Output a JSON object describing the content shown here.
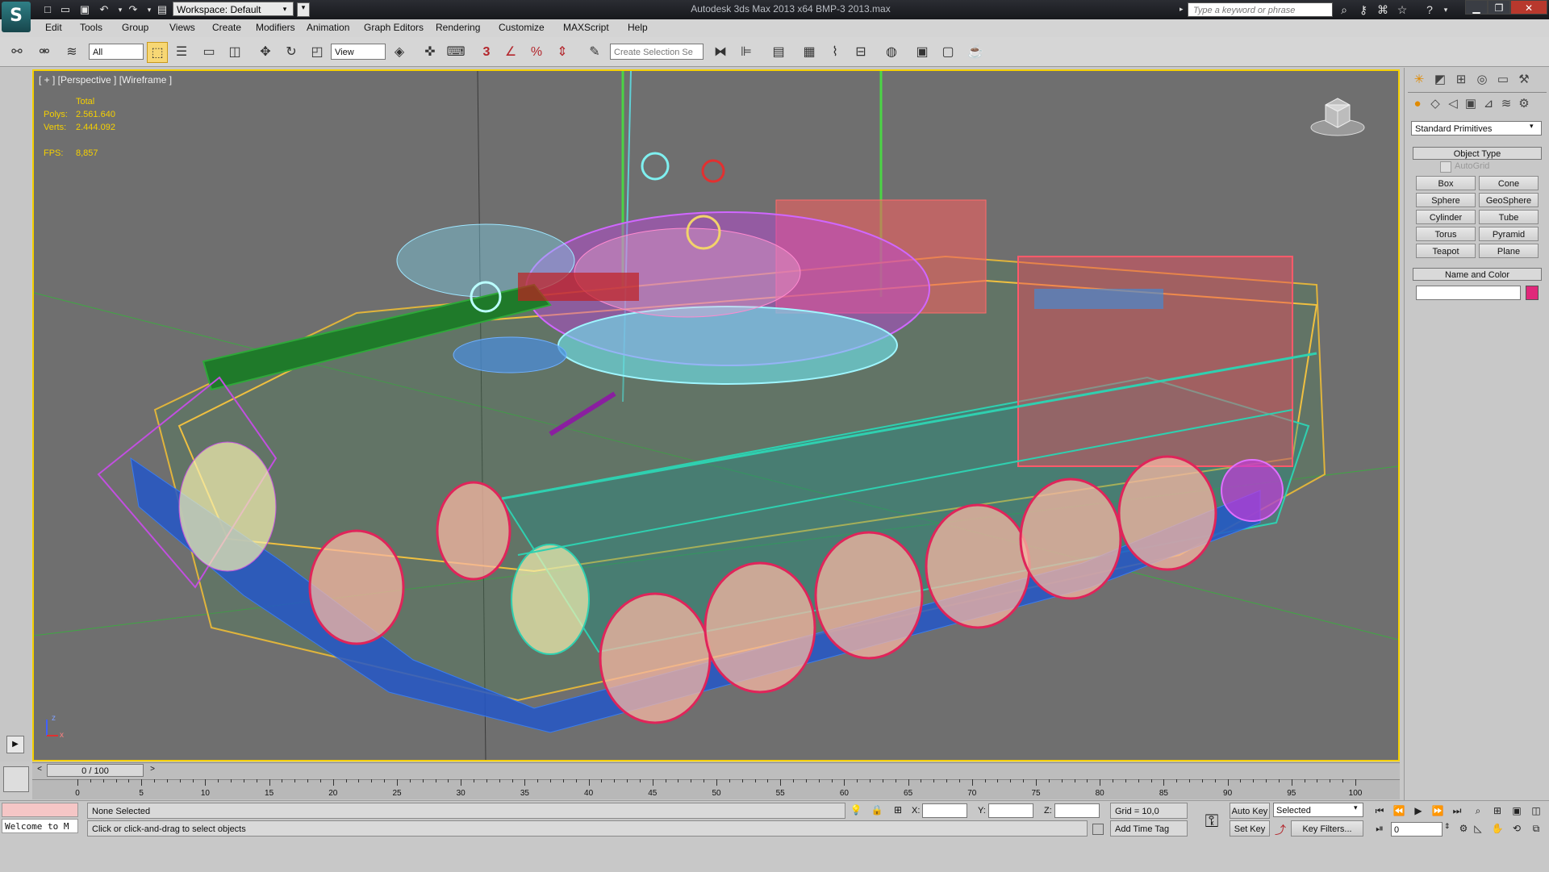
{
  "app": {
    "title": "Autodesk 3ds Max  2013 x64      BMP-3 2013.max",
    "workspace": "Workspace: Default",
    "search_placeholder": "Type a keyword or phrase"
  },
  "menu": [
    "Edit",
    "Tools",
    "Group",
    "Views",
    "Create",
    "Modifiers",
    "Animation",
    "Graph Editors",
    "Rendering",
    "Customize",
    "MAXScript",
    "Help"
  ],
  "toolbar": {
    "selection_filter": "All",
    "ref_coord": "View",
    "named_selection": "Create Selection Se",
    "snap_label": "3"
  },
  "viewport": {
    "label": "[ + ] [Perspective ] [Wireframe ]",
    "stats": {
      "total_label": "Total",
      "polys_label": "Polys:",
      "polys": "2.561.640",
      "verts_label": "Verts:",
      "verts": "2.444.092",
      "fps_label": "FPS:",
      "fps": "8,857"
    },
    "axis_z": "z",
    "axis_x": "x"
  },
  "command_panel": {
    "category": "Standard Primitives",
    "object_type_title": "Object Type",
    "autogrid": "AutoGrid",
    "buttons": [
      "Box",
      "Cone",
      "Sphere",
      "GeoSphere",
      "Cylinder",
      "Tube",
      "Torus",
      "Pyramid",
      "Teapot",
      "Plane"
    ],
    "name_color_title": "Name and Color",
    "object_color": "#e0287a"
  },
  "timeline": {
    "frame": "0 / 100",
    "ticks": [
      "0",
      "5",
      "10",
      "15",
      "20",
      "25",
      "30",
      "35",
      "40",
      "45",
      "50",
      "55",
      "60",
      "65",
      "70",
      "75",
      "80",
      "85",
      "90",
      "95",
      "100"
    ]
  },
  "status": {
    "selection": "None Selected",
    "prompt": "Click or click-and-drag to select objects",
    "maxscript": "Welcome to M",
    "x_label": "X:",
    "y_label": "Y:",
    "z_label": "Z:",
    "grid": "Grid = 10,0",
    "add_time_tag": "Add Time Tag",
    "auto_key": "Auto Key",
    "set_key": "Set Key",
    "key_mode": "Selected",
    "key_filters": "Key Filters...",
    "current_frame": "0"
  }
}
